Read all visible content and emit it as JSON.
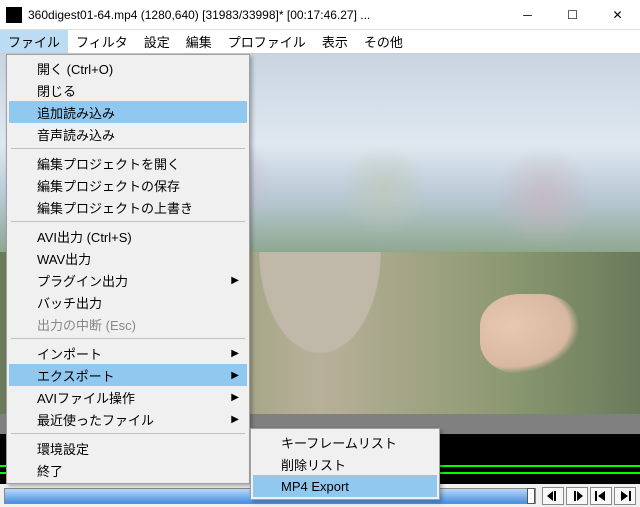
{
  "titlebar": {
    "title": "360digest01-64.mp4 (1280,640) [31983/33998]* [00:17:46.27] ..."
  },
  "menubar": {
    "items": [
      "ファイル",
      "フィルタ",
      "設定",
      "編集",
      "プロファイル",
      "表示",
      "その他"
    ]
  },
  "file_menu": {
    "open": "開く (Ctrl+O)",
    "close": "閉じる",
    "append": "追加読み込み",
    "audio": "音声読み込み",
    "open_project": "編集プロジェクトを開く",
    "save_project": "編集プロジェクトの保存",
    "overwrite_project": "編集プロジェクトの上書き",
    "avi_out": "AVI出力 (Ctrl+S)",
    "wav_out": "WAV出力",
    "plugin_out": "プラグイン出力",
    "batch_out": "バッチ出力",
    "cancel_out": "出力の中断 (Esc)",
    "import": "インポート",
    "export": "エクスポート",
    "avi_ops": "AVIファイル操作",
    "recent": "最近使ったファイル",
    "prefs": "環境設定",
    "quit": "終了"
  },
  "export_submenu": {
    "keyframe": "キーフレームリスト",
    "dellist": "削除リスト",
    "mp4": "MP4 Export"
  },
  "playback": {
    "prev_frame": "◀|",
    "next_frame": "|▶",
    "first": "|◀",
    "last": "▶|"
  }
}
